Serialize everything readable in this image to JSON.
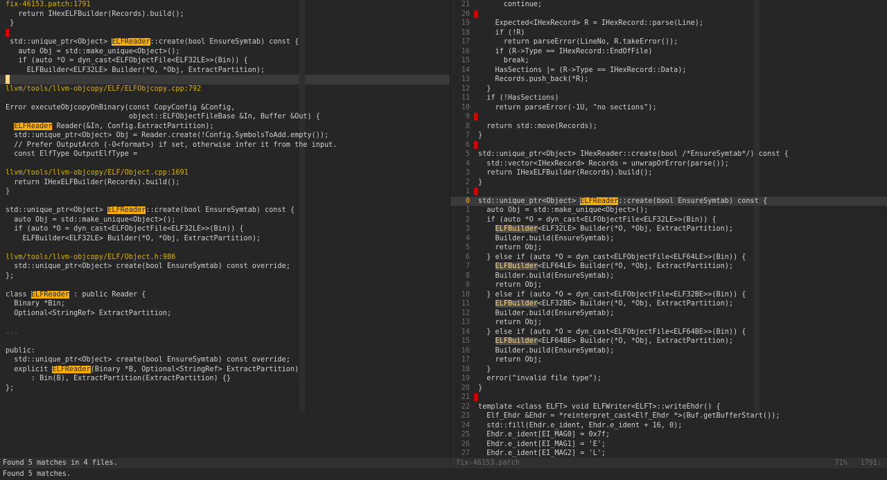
{
  "left_pane": {
    "lines": [
      {
        "kind": "file",
        "text": "fix-46153.patch:1791"
      },
      {
        "text": "   return IHexELFBuilder(Records).build();"
      },
      {
        "text": " }"
      },
      {
        "text": "",
        "sign": true
      },
      {
        "text": " std::unique_ptr<Object> ",
        "hl": "ELFReader",
        "after": "::create(bool EnsureSymtab) const {"
      },
      {
        "text": "   auto Obj = std::make_unique<Object>();"
      },
      {
        "text": "   if (auto *O = dyn_cast<ELFObjectFile<ELF32LE>>(Bin)) {"
      },
      {
        "text": "     ELFBuilder<ELF32LE> Builder(*O, *Obj, ExtractPartition);"
      },
      {
        "text": ""
      },
      {
        "kind": "file",
        "text": "llvm/tools/llvm-objcopy/ELF/ELFObjcopy.cpp:792"
      },
      {
        "text": ""
      },
      {
        "text": "Error executeObjcopyOnBinary(const CopyConfig &Config,"
      },
      {
        "text": "                             object::ELFObjectFileBase &In, Buffer &Out) {"
      },
      {
        "text": "  ",
        "hl": "ELFReader",
        "after": " Reader(&In, Config.ExtractPartition);"
      },
      {
        "text": "  std::unique_ptr<Object> Obj = Reader.create(!Config.SymbolsToAdd.empty());"
      },
      {
        "text": "  // Prefer OutputArch (-O<format>) if set, otherwise infer it from the input."
      },
      {
        "text": "  const ElfType OutputElfType ="
      },
      {
        "text": ""
      },
      {
        "kind": "file",
        "text": "llvm/tools/llvm-objcopy/ELF/Object.cpp:1691"
      },
      {
        "text": "  return IHexELFBuilder(Records).build();"
      },
      {
        "text": "}"
      },
      {
        "text": ""
      },
      {
        "text": "std::unique_ptr<Object> ",
        "hl": "ELFReader",
        "after": "::create(bool EnsureSymtab) const {"
      },
      {
        "text": "  auto Obj = std::make_unique<Object>();"
      },
      {
        "text": "  if (auto *O = dyn_cast<ELFObjectFile<ELF32LE>>(Bin)) {"
      },
      {
        "text": "    ELFBuilder<ELF32LE> Builder(*O, *Obj, ExtractPartition);"
      },
      {
        "text": ""
      },
      {
        "kind": "file",
        "text": "llvm/tools/llvm-objcopy/ELF/Object.h:986"
      },
      {
        "text": "  std::unique_ptr<Object> create(bool EnsureSymtab) const override;"
      },
      {
        "text": "};"
      },
      {
        "text": ""
      },
      {
        "text": "class ",
        "hl": "ELFReader",
        "after": " : public Reader {"
      },
      {
        "text": "  Binary *Bin;"
      },
      {
        "text": "  Optional<StringRef> ExtractPartition;"
      },
      {
        "text": ""
      },
      {
        "kind": "muted",
        "text": "..."
      },
      {
        "text": ""
      },
      {
        "text": "public:"
      },
      {
        "text": "  std::unique_ptr<Object> create(bool EnsureSymtab) const override;"
      },
      {
        "text": "  explicit ",
        "hl": "ELFReader",
        "after": "(Binary *B, Optional<StringRef> ExtractPartition)"
      },
      {
        "text": "      : Bin(B), ExtractPartition(ExtractPartition) {}"
      },
      {
        "text": "};"
      }
    ],
    "status": "Found 5 matches in 4 files."
  },
  "right_pane": {
    "lines": [
      {
        "n": "21",
        "text": "      continue;"
      },
      {
        "n": "20",
        "text": "",
        "sign": true
      },
      {
        "n": "19",
        "text": "    Expected<IHexRecord> R = IHexRecord::parse(Line);"
      },
      {
        "n": "18",
        "text": "    if (!R)"
      },
      {
        "n": "17",
        "text": "      return parseError(LineNo, R.takeError());"
      },
      {
        "n": "16",
        "text": "    if (R->Type == IHexRecord::EndOfFile)"
      },
      {
        "n": "15",
        "text": "      break;"
      },
      {
        "n": "14",
        "text": "    HasSections |= (R->Type == IHexRecord::Data);"
      },
      {
        "n": "13",
        "text": "    Records.push_back(*R);"
      },
      {
        "n": "12",
        "text": "  }"
      },
      {
        "n": "11",
        "text": "  if (!HasSections)"
      },
      {
        "n": "10",
        "text": "    return parseError(-1U, \"no sections\");"
      },
      {
        "n": "9",
        "text": "",
        "sign": true
      },
      {
        "n": "8",
        "text": "  return std::move(Records);"
      },
      {
        "n": "7",
        "text": "}"
      },
      {
        "n": "6",
        "text": "",
        "sign": true
      },
      {
        "n": "5",
        "text": "std::unique_ptr<Object> IHexReader::create(bool /*EnsureSymtab*/) const {"
      },
      {
        "n": "4",
        "text": "  std::vector<IHexRecord> Records = unwrapOrError(parse());"
      },
      {
        "n": "3",
        "text": "  return IHexELFBuilder(Records).build();"
      },
      {
        "n": "2",
        "text": "}"
      },
      {
        "n": "1",
        "text": "",
        "sign": true
      },
      {
        "n": "0",
        "cursor": true,
        "text": "std::unique_ptr<Object> ",
        "hl": "ELFReader",
        "after": "::create(bool EnsureSymtab) const {"
      },
      {
        "n": "1",
        "text": "  auto Obj = std::make_unique<Object>();"
      },
      {
        "n": "2",
        "text": "  if (auto *O = dyn_cast<ELFObjectFile<ELF32LE>>(Bin)) {"
      },
      {
        "n": "3",
        "text": "    ",
        "hl2": "ELFBuilder",
        "after": "<ELF32LE> Builder(*O, *Obj, ExtractPartition);"
      },
      {
        "n": "4",
        "text": "    Builder.build(EnsureSymtab);"
      },
      {
        "n": "5",
        "text": "    return Obj;"
      },
      {
        "n": "6",
        "text": "  } else if (auto *O = dyn_cast<ELFObjectFile<ELF64LE>>(Bin)) {"
      },
      {
        "n": "7",
        "text": "    ",
        "hl2": "ELFBuilder",
        "after": "<ELF64LE> Builder(*O, *Obj, ExtractPartition);"
      },
      {
        "n": "8",
        "text": "    Builder.build(EnsureSymtab);"
      },
      {
        "n": "9",
        "text": "    return Obj;"
      },
      {
        "n": "10",
        "text": "  } else if (auto *O = dyn_cast<ELFObjectFile<ELF32BE>>(Bin)) {"
      },
      {
        "n": "11",
        "text": "    ",
        "hl2": "ELFBuilder",
        "after": "<ELF32BE> Builder(*O, *Obj, ExtractPartition);"
      },
      {
        "n": "12",
        "text": "    Builder.build(EnsureSymtab);"
      },
      {
        "n": "13",
        "text": "    return Obj;"
      },
      {
        "n": "14",
        "text": "  } else if (auto *O = dyn_cast<ELFObjectFile<ELF64BE>>(Bin)) {"
      },
      {
        "n": "15",
        "text": "    ",
        "hl2": "ELFBuilder",
        "after": "<ELF64BE> Builder(*O, *Obj, ExtractPartition);"
      },
      {
        "n": "16",
        "text": "    Builder.build(EnsureSymtab);"
      },
      {
        "n": "17",
        "text": "    return Obj;"
      },
      {
        "n": "18",
        "text": "  }"
      },
      {
        "n": "19",
        "text": "  error(\"invalid file type\");"
      },
      {
        "n": "20",
        "text": "}"
      },
      {
        "n": "21",
        "text": "",
        "sign": true
      },
      {
        "n": "22",
        "text": "template <class ELFT> void ELFWriter<ELFT>::writeEhdr() {"
      },
      {
        "n": "23",
        "text": "  Elf_Ehdr &Ehdr = *reinterpret_cast<Elf_Ehdr *>(Buf.getBufferStart());"
      },
      {
        "n": "24",
        "text": "  std::fill(Ehdr.e_ident, Ehdr.e_ident + 16, 0);"
      },
      {
        "n": "25",
        "text": "  Ehdr.e_ident[EI_MAG0] = 0x7f;"
      },
      {
        "n": "26",
        "text": "  Ehdr.e_ident[EI_MAG1] = 'E';"
      },
      {
        "n": "27",
        "text": "  Ehdr.e_ident[EI_MAG2] = 'L';"
      }
    ],
    "status_file": "fix-46153.patch",
    "status_percent": "71%",
    "status_line": "1791:"
  },
  "cmdline": "Found 5 matches."
}
